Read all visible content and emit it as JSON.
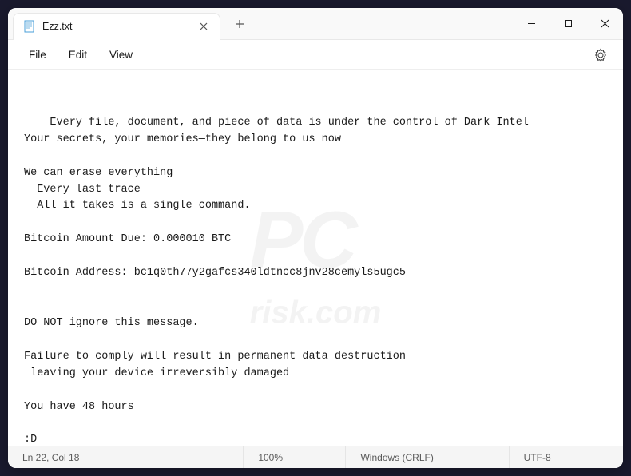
{
  "tab": {
    "title": "Ezz.txt"
  },
  "menu": {
    "file": "File",
    "edit": "Edit",
    "view": "View"
  },
  "document": {
    "content": "Every file, document, and piece of data is under the control of Dark Intel\nYour secrets, your memories—they belong to us now\n\nWe can erase everything\n  Every last trace\n  All it takes is a single command.\n\nBitcoin Amount Due: 0.000010 BTC\n\nBitcoin Address: bc1q0th77y2gafcs340ldtncc8jnv28cemyls5ugc5\n\n\nDO NOT ignore this message.\n\nFailure to comply will result in permanent data destruction\n leaving your device irreversibly damaged\n\nYou have 48 hours\n\n:D\n\nWe see everything"
  },
  "statusbar": {
    "position": "Ln 22, Col 18",
    "zoom": "100%",
    "line_ending": "Windows (CRLF)",
    "encoding": "UTF-8"
  },
  "watermark": {
    "main": "PC",
    "sub": "risk.com"
  }
}
